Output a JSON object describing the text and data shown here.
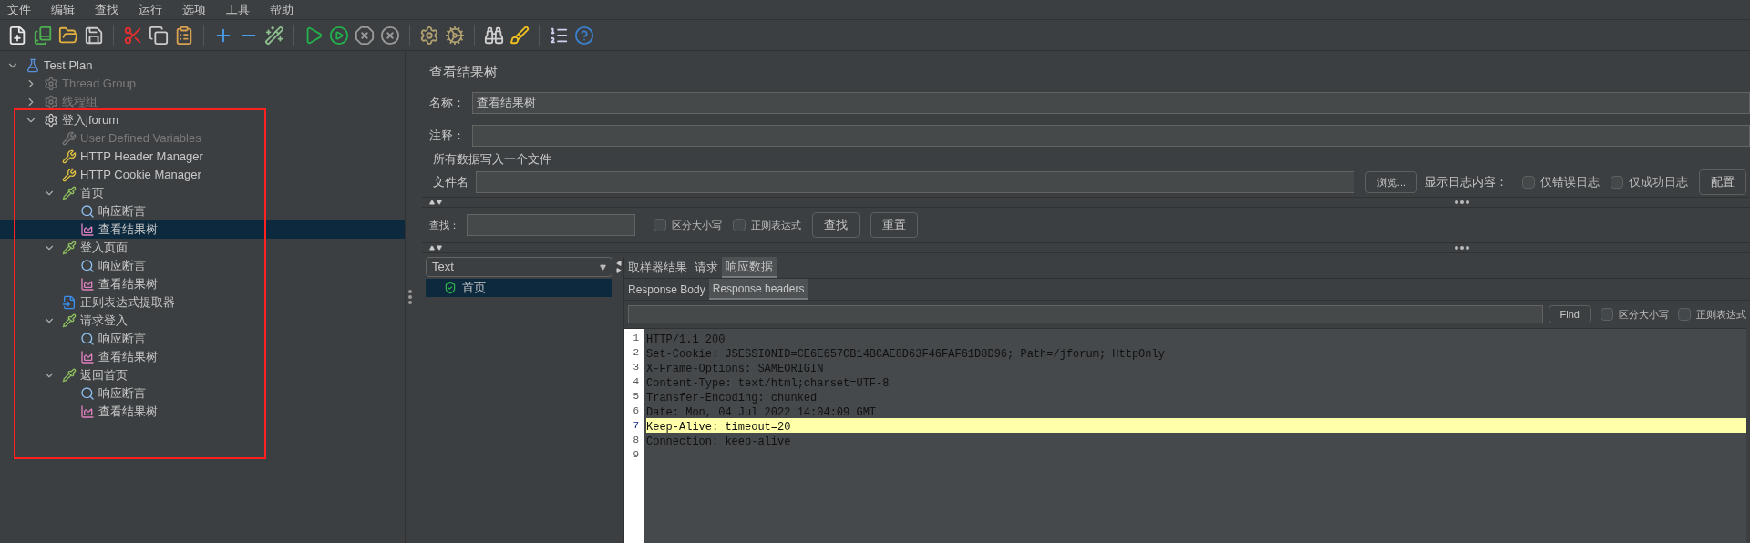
{
  "menu": [
    "文件",
    "编辑",
    "查找",
    "运行",
    "选项",
    "工具",
    "帮助"
  ],
  "toolbar": [
    {
      "kind": "new"
    },
    {
      "kind": "templates"
    },
    {
      "kind": "open"
    },
    {
      "kind": "save"
    },
    {
      "kind": "sep"
    },
    {
      "kind": "cut"
    },
    {
      "kind": "copy"
    },
    {
      "kind": "paste"
    },
    {
      "kind": "sep"
    },
    {
      "kind": "expand"
    },
    {
      "kind": "collapse"
    },
    {
      "kind": "toggle"
    },
    {
      "kind": "sep"
    },
    {
      "kind": "start"
    },
    {
      "kind": "start-no-pause"
    },
    {
      "kind": "stop"
    },
    {
      "kind": "shutdown"
    },
    {
      "kind": "sep"
    },
    {
      "kind": "clear"
    },
    {
      "kind": "clear-all"
    },
    {
      "kind": "sep"
    },
    {
      "kind": "search"
    },
    {
      "kind": "reset"
    },
    {
      "kind": "sep"
    },
    {
      "kind": "functions"
    },
    {
      "kind": "help"
    }
  ],
  "tree": [
    {
      "label": "Test Plan",
      "kind": "plan",
      "expanded": true,
      "disabled": false,
      "selected": false,
      "children": [
        {
          "label": "Thread Group",
          "kind": "group",
          "expanded": false,
          "disabled": true,
          "selected": false
        },
        {
          "label": "线程组",
          "kind": "group",
          "expanded": false,
          "disabled": true,
          "selected": false
        },
        {
          "label": "登入jforum",
          "kind": "group",
          "expanded": true,
          "disabled": false,
          "selected": false,
          "children": [
            {
              "label": "User Defined Variables",
              "kind": "config",
              "disabled": true,
              "selected": false
            },
            {
              "label": "HTTP Header Manager",
              "kind": "config",
              "disabled": false,
              "selected": false
            },
            {
              "label": "HTTP Cookie Manager",
              "kind": "config",
              "disabled": false,
              "selected": false
            },
            {
              "label": "首页",
              "kind": "sampler",
              "expanded": true,
              "disabled": false,
              "selected": false,
              "children": [
                {
                  "label": "响应断言",
                  "kind": "assertion",
                  "disabled": false,
                  "selected": false
                },
                {
                  "label": "查看结果树",
                  "kind": "listener",
                  "disabled": false,
                  "selected": true
                }
              ]
            },
            {
              "label": "登入页面",
              "kind": "sampler",
              "expanded": true,
              "disabled": false,
              "selected": false,
              "children": [
                {
                  "label": "响应断言",
                  "kind": "assertion",
                  "disabled": false,
                  "selected": false
                },
                {
                  "label": "查看结果树",
                  "kind": "listener",
                  "disabled": false,
                  "selected": false
                }
              ]
            },
            {
              "label": "正则表达式提取器",
              "kind": "extractor",
              "disabled": false,
              "selected": false
            },
            {
              "label": "请求登入",
              "kind": "sampler",
              "expanded": true,
              "disabled": false,
              "selected": false,
              "children": [
                {
                  "label": "响应断言",
                  "kind": "assertion",
                  "disabled": false,
                  "selected": false
                },
                {
                  "label": "查看结果树",
                  "kind": "listener",
                  "disabled": false,
                  "selected": false
                }
              ]
            },
            {
              "label": "返回首页",
              "kind": "sampler",
              "expanded": true,
              "disabled": false,
              "selected": false,
              "children": [
                {
                  "label": "响应断言",
                  "kind": "assertion",
                  "disabled": false,
                  "selected": false
                },
                {
                  "label": "查看结果树",
                  "kind": "listener",
                  "disabled": false,
                  "selected": false
                }
              ]
            }
          ]
        }
      ]
    }
  ],
  "panel": {
    "title": "查看结果树",
    "name_label": "名称：",
    "name_value": "查看结果树",
    "comment_label": "注释：",
    "file_group": "所有数据写入一个文件",
    "file_label": "文件名",
    "browse": "浏览...",
    "log_label": "显示日志内容：",
    "log_options": [
      {
        "label": "仅错误日志",
        "checked": false
      },
      {
        "label": "仅成功日志",
        "checked": false
      }
    ],
    "configure": "配置",
    "search_label": "查找：",
    "search_options": [
      {
        "label": "区分大小写",
        "checked": false
      },
      {
        "label": "正则表达式",
        "checked": false
      }
    ],
    "search_button": "查找",
    "reset_button": "重置"
  },
  "results": {
    "renderer": "Text",
    "samples": [
      {
        "label": "首页",
        "selected": true
      }
    ],
    "tabs": [
      {
        "label": "取样器结果",
        "selected": false
      },
      {
        "label": "请求",
        "selected": false
      },
      {
        "label": "响应数据",
        "selected": true
      }
    ],
    "subtabs": [
      {
        "label": "Response Body",
        "selected": false
      },
      {
        "label": "Response headers",
        "selected": true
      }
    ],
    "find_button": "Find",
    "find_options": [
      {
        "label": "区分大小写",
        "checked": false
      },
      {
        "label": "正则表达式",
        "checked": false
      }
    ],
    "lines": [
      {
        "number": "1",
        "text": "HTTP/1.1 200",
        "selected": false
      },
      {
        "number": "2",
        "text": "Set-Cookie: JSESSIONID=CE6E657CB14BCAE8D63F46FAF61D8D96; Path=/jforum; HttpOnly",
        "selected": false
      },
      {
        "number": "3",
        "text": "X-Frame-Options: SAMEORIGIN",
        "selected": false
      },
      {
        "number": "4",
        "text": "Content-Type: text/html;charset=UTF-8",
        "selected": false
      },
      {
        "number": "5",
        "text": "Transfer-Encoding: chunked",
        "selected": false
      },
      {
        "number": "6",
        "text": "Date: Mon, 04 Jul 2022 14:04:09 GMT",
        "selected": false
      },
      {
        "number": "7",
        "text": "Keep-Alive: timeout=20",
        "selected": true
      },
      {
        "number": "8",
        "text": "Connection: keep-alive",
        "selected": false
      },
      {
        "number": "9",
        "selected": false
      }
    ]
  }
}
